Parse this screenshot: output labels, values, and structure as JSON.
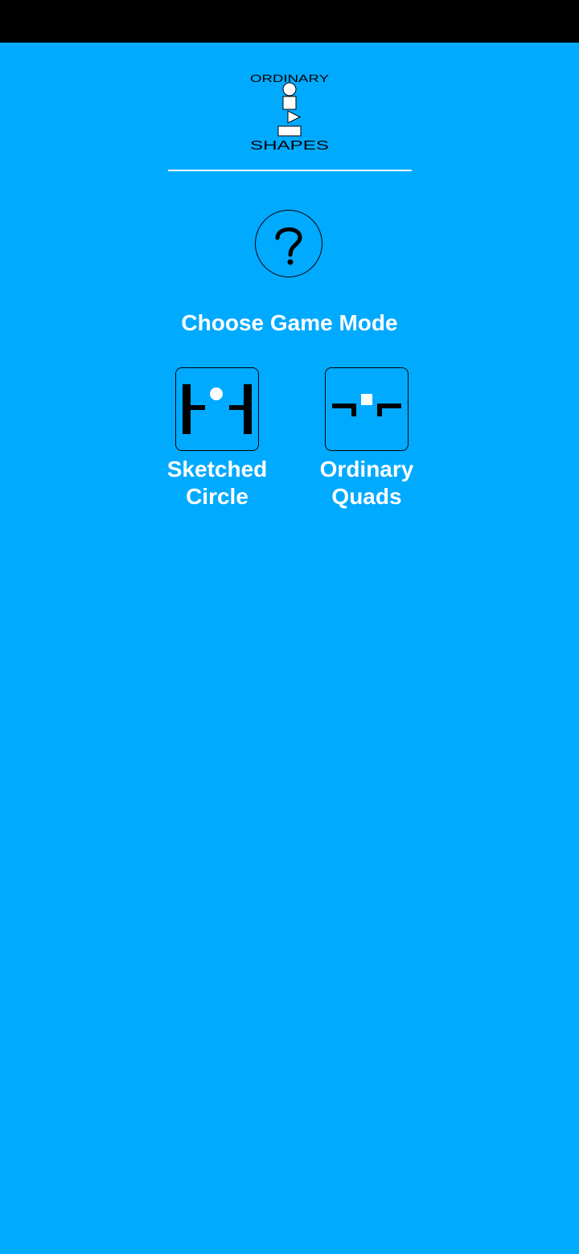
{
  "colors": {
    "background": "#00aaff",
    "status_bar": "#000000",
    "text": "#ffffff",
    "outline": "#000000"
  },
  "logo": {
    "top_word": "Ordinary",
    "bottom_word": "Shapes",
    "icon": "stacked-shapes-logo"
  },
  "help": {
    "icon": "question-mark-icon"
  },
  "mode_title": "Choose Game Mode",
  "modes": [
    {
      "icon": "paddles-ball-icon",
      "label_line1": "Sketched",
      "label_line2": "Circle"
    },
    {
      "icon": "paddles-square-icon",
      "label_line1": "Ordinary",
      "label_line2": "Quads"
    }
  ]
}
